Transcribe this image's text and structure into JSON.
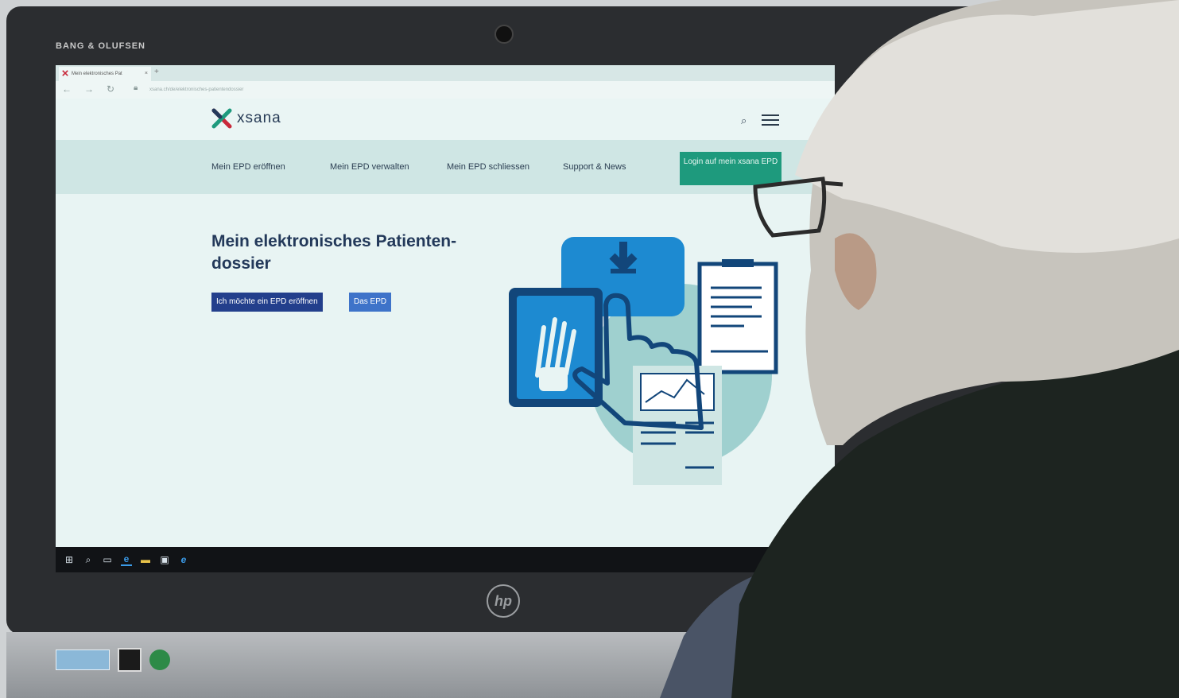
{
  "monitor": {
    "brand_label": "BANG & OLUFSEN",
    "maker_logo": "hp"
  },
  "browser": {
    "tab_title": "Mein elektronisches Pat",
    "tab_close": "×",
    "new_tab": "+",
    "url_text": "xsana.ch/de/elektronisches-patientendossier"
  },
  "site": {
    "logo_text": "xsana",
    "nav": [
      "Mein EPD eröffnen",
      "Mein EPD verwalten",
      "Mein EPD schliessen",
      "Support & News"
    ],
    "login_button": "Login auf mein xsana EPD",
    "hero_title": "Mein elektronisches Patienten-dossier",
    "cta_primary": "Ich möchte ein EPD eröffnen",
    "cta_secondary": "Das EPD"
  },
  "colors": {
    "accent_green": "#1e9a7d",
    "primary_blue": "#233f8c",
    "secondary_blue": "#3e73c9",
    "title_navy": "#23395a",
    "logo_red": "#c8283a"
  },
  "taskbar": {
    "icons": [
      "windows-start-icon",
      "search-icon",
      "task-view-icon",
      "edge-icon",
      "file-explorer-icon",
      "store-icon",
      "ie-icon"
    ]
  }
}
